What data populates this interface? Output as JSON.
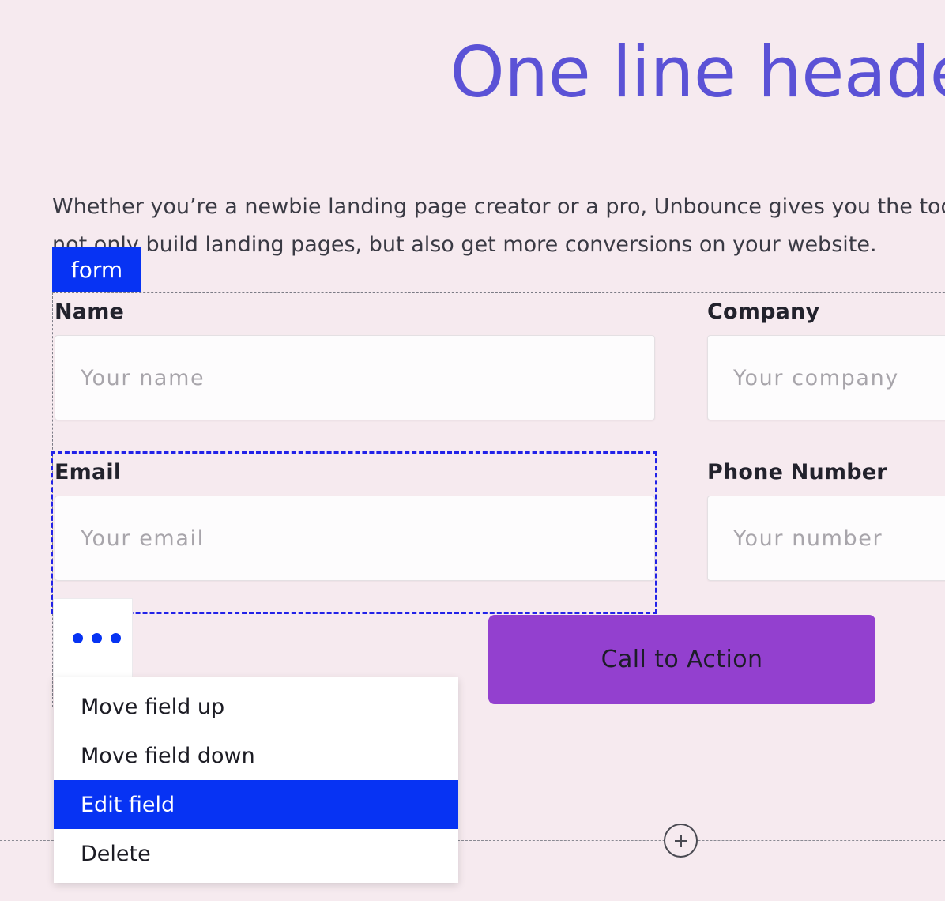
{
  "page": {
    "background_color": "#f6eaef",
    "title": "One line header",
    "title_color": "#5b52d6",
    "intro": "Whether you’re a newbie landing page creator or a pro, Unbounce gives you the tools to not only build landing pages, but also get more conversions on your website."
  },
  "form": {
    "badge_label": "form",
    "badge_color": "#0733f3",
    "selected_field": "Email",
    "fields": [
      {
        "label": "Name",
        "placeholder": "Your name",
        "value": "",
        "selected": false,
        "column": "left"
      },
      {
        "label": "Company",
        "placeholder": "Your company",
        "value": "",
        "selected": false,
        "column": "right"
      },
      {
        "label": "Email",
        "placeholder": "Your email",
        "value": "",
        "selected": true,
        "column": "left"
      },
      {
        "label": "Phone Number",
        "placeholder": "Your number",
        "value": "",
        "selected": false,
        "column": "right"
      }
    ],
    "cta": {
      "label": "Call to Action",
      "color": "#9340cf",
      "text_color": "#1d1d28"
    }
  },
  "field_menu": {
    "trigger_icon": "kebab-menu-icon",
    "dot_color": "#0733f3",
    "highlight_color": "#0733f3",
    "items": [
      {
        "label": "Move field up",
        "highlighted": false
      },
      {
        "label": "Move field down",
        "highlighted": false
      },
      {
        "label": "Edit field",
        "highlighted": true
      },
      {
        "label": "Delete",
        "highlighted": false
      }
    ]
  },
  "section_control": {
    "add_icon": "plus-icon",
    "add_label": "+"
  }
}
